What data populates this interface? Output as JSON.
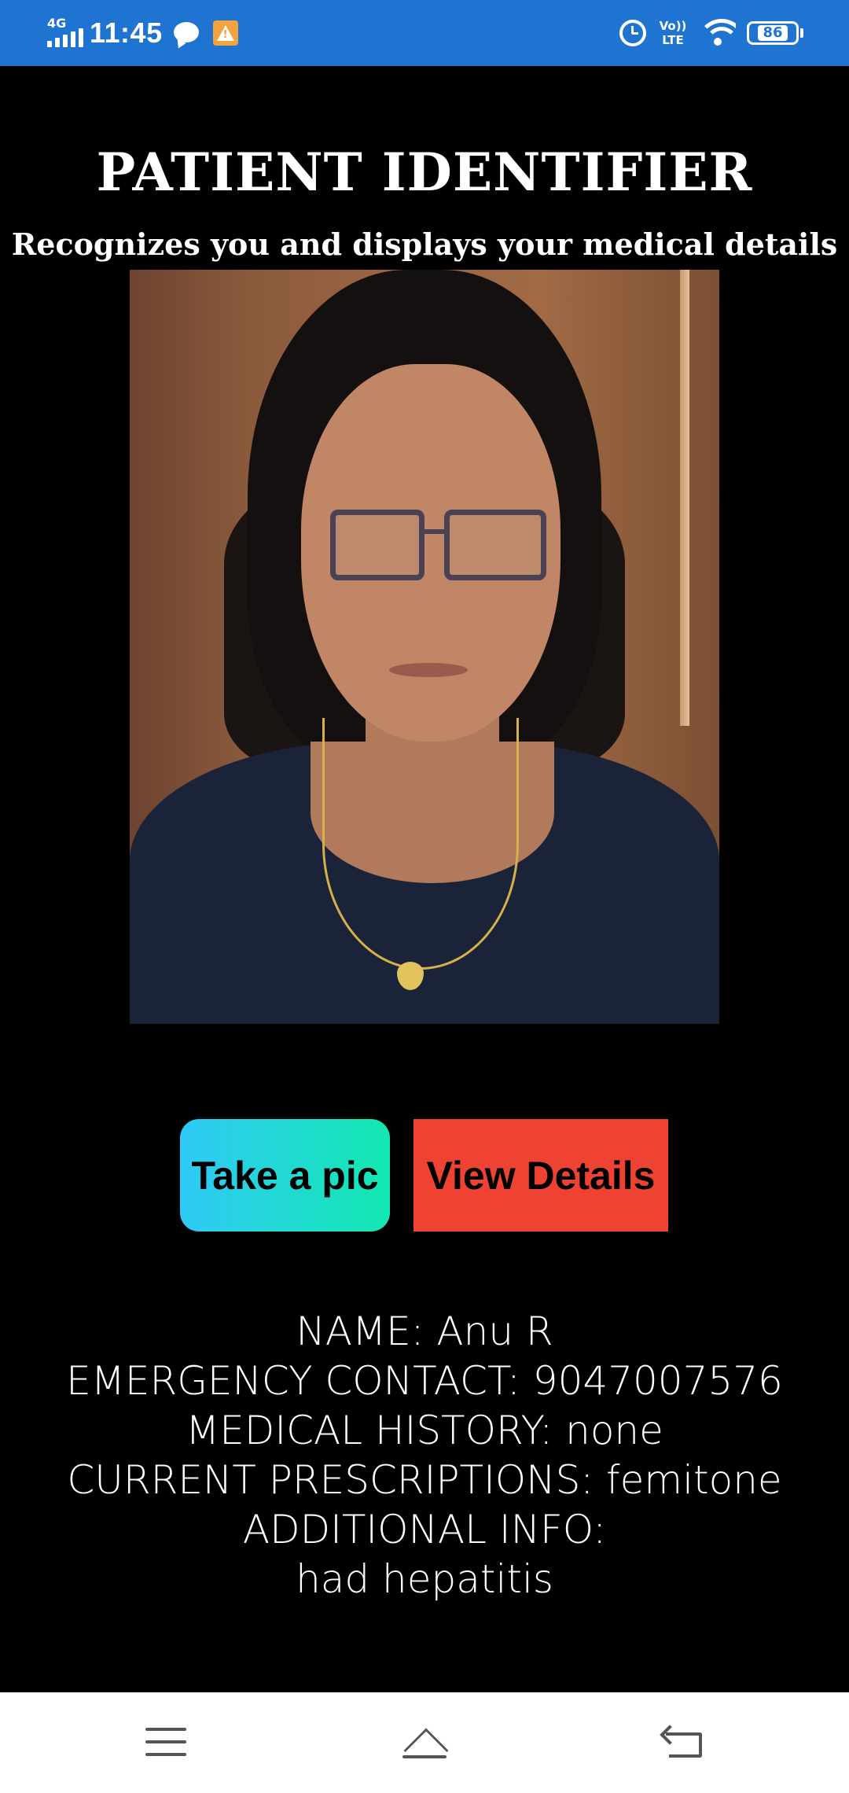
{
  "status_bar": {
    "network": "4G",
    "time": "11:45",
    "icons": [
      "chat-icon",
      "warning-icon",
      "alarm-icon",
      "volte-icon",
      "wifi-icon",
      "battery-icon"
    ],
    "volte_top": "Vo))",
    "volte_bottom": "LTE",
    "battery": "86",
    "color": "#1E74D0"
  },
  "header": {
    "title": "PATIENT IDENTIFIER",
    "subtitle": "Recognizes you and displays your medical details"
  },
  "photo": {
    "description_icon": "patient-photo"
  },
  "buttons": {
    "take_pic": "Take a pic",
    "view_details": "View Details",
    "take_pic_colors": [
      "#2FC9F6",
      "#13E8B0"
    ],
    "view_details_color": "#EE4232"
  },
  "details": {
    "name": "NAME: Anu R",
    "emergency_contact": "EMERGENCY CONTACT: 9047007576",
    "medical_history": "MEDICAL HISTORY: none",
    "current_prescriptions": "CURRENT PRESCRIPTIONS: femitone",
    "additional_info_label": "ADDITIONAL INFO:",
    "additional_info_value": "had hepatitis"
  },
  "nav_bar": {
    "icons": [
      "menu-icon",
      "home-icon",
      "back-icon"
    ]
  }
}
